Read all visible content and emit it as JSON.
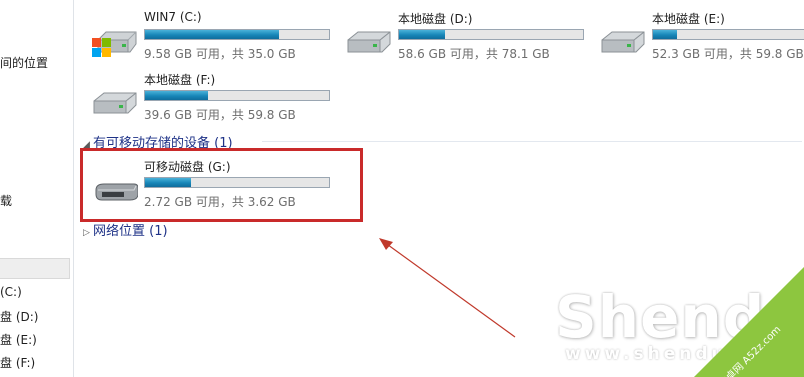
{
  "nav": {
    "items": [
      {
        "label": "间的位置"
      },
      {
        "label": "载"
      },
      {
        "label": "(C:)"
      },
      {
        "label": "盘 (D:)"
      },
      {
        "label": "盘 (E:)"
      },
      {
        "label": "盘 (F:)"
      }
    ]
  },
  "drives": [
    {
      "name": "WIN7 (C:)",
      "info": "9.58 GB 可用，共 35.0 GB",
      "used_fraction": 0.73,
      "icon": "system-drive-icon"
    },
    {
      "name": "本地磁盘 (D:)",
      "info": "58.6 GB 可用，共 78.1 GB",
      "used_fraction": 0.25,
      "icon": "hard-drive-icon"
    },
    {
      "name": "本地磁盘 (E:)",
      "info": "52.3 GB 可用，共 59.8 GB",
      "used_fraction": 0.13,
      "icon": "hard-drive-icon"
    },
    {
      "name": "本地磁盘 (F:)",
      "info": "39.6 GB 可用，共 59.8 GB",
      "used_fraction": 0.34,
      "icon": "hard-drive-icon"
    }
  ],
  "removable_group": {
    "label": "有可移动存储的设备 (1)"
  },
  "removable": {
    "name": "可移动磁盘 (G:)",
    "info": "2.72 GB 可用，共 3.62 GB",
    "used_fraction": 0.25,
    "icon": "removable-drive-icon"
  },
  "network_group": {
    "label": "网络位置 (1)"
  },
  "watermark": {
    "main": "Shendu",
    "sub": "www.shendu.c",
    "corner": "飞卓网 A52z.com"
  },
  "colors": {
    "highlight": "#c92a2a",
    "arrow": "#c0392b",
    "bar_fill": "#1786b8",
    "corner": "#8dc63f"
  }
}
